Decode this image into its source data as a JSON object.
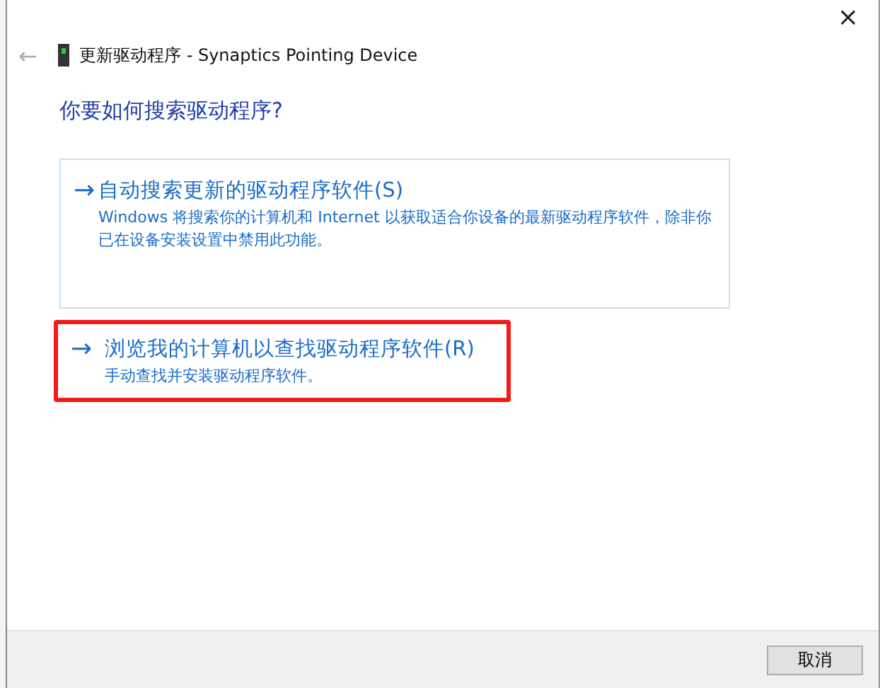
{
  "window": {
    "title": "更新驱动程序 - Synaptics Pointing Device",
    "close": "×",
    "back": "←"
  },
  "heading": "你要如何搜索驱动程序?",
  "options": [
    {
      "arrow": "→",
      "title": "自动搜索更新的驱动程序软件(S)",
      "description": "Windows 将搜索你的计算机和 Internet 以获取适合你设备的最新驱动程序软件，除非你已在设备安装设置中禁用此功能。",
      "focused": true,
      "highlighted": false
    },
    {
      "arrow": "→",
      "title": "浏览我的计算机以查找驱动程序软件(R)",
      "description": "手动查找并安装驱动程序软件。",
      "focused": false,
      "highlighted": true
    }
  ],
  "buttons": [
    "取消"
  ]
}
